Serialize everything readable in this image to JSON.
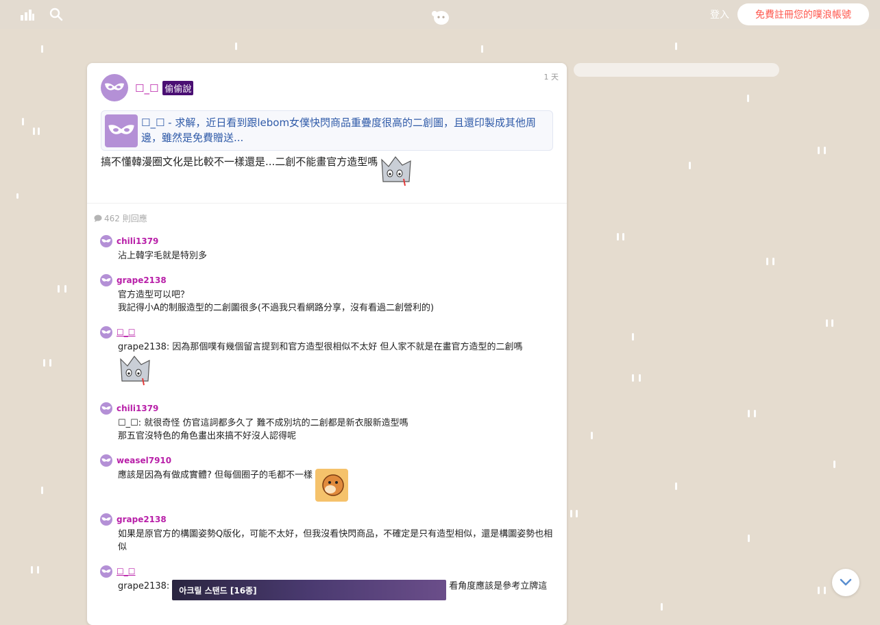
{
  "topbar": {
    "login_label": "登入",
    "register_label": "免費註冊您的噗浪帳號",
    "icons": [
      "stats-icon",
      "search-icon",
      "plurk-logo-icon"
    ]
  },
  "post": {
    "time": "1 天",
    "author": "☐_☐",
    "badge": "偷偷說",
    "quote_text": "☐_☐ - 求解，近日看到跟lebom女僕快閃商品重疊度很高的二創圖，且還印製成其他周邊，雖然是免費贈送...",
    "content": "搞不懂韓漫圈文化是比較不一樣還是...二創不能畫官方造型嗎",
    "reply_count": "462 則回應"
  },
  "responses": [
    {
      "user": "chili1379",
      "lines": [
        "沾上韓字毛就是特別多"
      ]
    },
    {
      "user": "grape2138",
      "lines": [
        "官方造型可以吧？",
        "我記得小A的制服造型的二創圖很多(不過我只看網路分享，沒有看過二創營利的)"
      ]
    },
    {
      "user": "☐_☐",
      "lines": [
        "grape2138: 因為那個噗有幾個留言提到和官方造型很相似不太好 但人家不就是在畫官方造型的二創嗎"
      ]
    },
    {
      "user": "chili1379",
      "lines": [
        "☐_☐: 就很奇怪 仿官這詞都多久了 難不成別坑的二創都是新衣服新造型嗎",
        "那五官沒特色的角色畫出來搞不好沒人認得呢"
      ]
    },
    {
      "user": "weasel7910",
      "lines": [
        "應該是因為有做成實體? 但每個圈子的毛都不一樣"
      ]
    },
    {
      "user": "grape2138",
      "lines": [
        "如果是原官方的構圖姿勢Q版化，可能不太好，但我沒看快閃商品，不確定是只有造型相似，還是構圖姿勢也相似"
      ]
    },
    {
      "user": "☐_☐",
      "lines": [
        "grape2138:",
        "看角度應該是參考立牌這"
      ],
      "image_caption": "아크릴 스탠드 [16종]"
    }
  ],
  "colors": {
    "background": "#e5dccf",
    "username": "#b81fa8",
    "badge_bg": "#4a0f73",
    "quote_text": "#2f5aa8",
    "register_text": "#ff574d",
    "avatar": "#b490d6"
  }
}
